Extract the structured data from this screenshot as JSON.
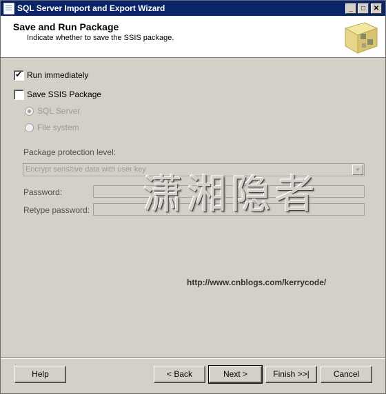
{
  "window": {
    "title": "SQL Server Import and Export Wizard",
    "controls": {
      "minimize": "_",
      "maximize": "□",
      "close": "✕"
    }
  },
  "header": {
    "title": "Save and Run Package",
    "subtitle": "Indicate whether to save the SSIS package."
  },
  "options": {
    "run_immediately": {
      "label": "Run immediately",
      "checked": true
    },
    "save_ssis": {
      "label": "Save SSIS Package",
      "checked": false
    },
    "sql_server": {
      "label": "SQL Server",
      "selected": true
    },
    "file_system": {
      "label": "File system",
      "selected": false
    }
  },
  "protection": {
    "label": "Package protection level:",
    "selected": "Encrypt sensitive data with user key"
  },
  "password": {
    "label": "Password:",
    "value": ""
  },
  "retype": {
    "label": "Retype password:",
    "value": ""
  },
  "watermark": {
    "text": "潇湘隐者"
  },
  "url": "http://www.cnblogs.com/kerrycode/",
  "buttons": {
    "help": "Help",
    "back": "< Back",
    "next": "Next >",
    "finish": "Finish >>|",
    "cancel": "Cancel"
  }
}
